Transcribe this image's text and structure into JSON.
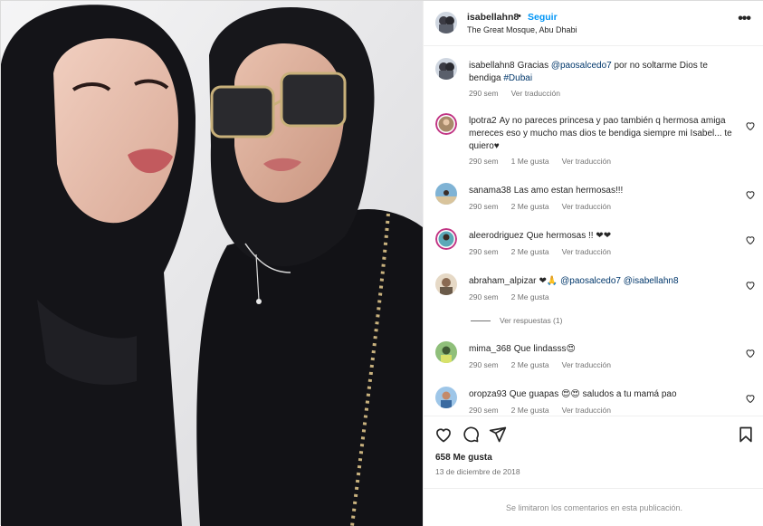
{
  "header": {
    "username": "isabellahn8",
    "separator": "•",
    "follow_label": "Seguir",
    "location": "The Great Mosque, Abu Dhabi",
    "more_icon": "more-options-icon"
  },
  "caption": {
    "username": "isabellahn8",
    "text_before": "Gracias ",
    "mention": "@paosalcedo7",
    "text_after": " por no soltarme Dios te bendiga ",
    "hashtag": "#Dubai",
    "time": "290 sem",
    "translate": "Ver traducción"
  },
  "comments": [
    {
      "username": "lpotra2",
      "text": "Ay no pareces princesa y pao también q hermosa amiga mereces eso y mucho mas dios te bendiga siempre mi Isabel... te quiero♥",
      "time": "290 sem",
      "likes": "1 Me gusta",
      "translate": "Ver traducción"
    },
    {
      "username": "sanama38",
      "text": "Las amo estan hermosas!!!",
      "time": "290 sem",
      "likes": "2 Me gusta",
      "translate": "Ver traducción"
    },
    {
      "username": "aleerodriguez",
      "text": "Que hermosas !! ❤❤",
      "time": "290 sem",
      "likes": "2 Me gusta",
      "translate": "Ver traducción"
    },
    {
      "username": "abraham_alpizar",
      "text_before": "❤🙏 ",
      "mention1": "@paosalcedo7",
      "mention2": "@isabellahn8",
      "time": "290 sem",
      "likes": "2 Me gusta"
    },
    {
      "username": "mima_368",
      "text": "Que lindasss😍",
      "time": "290 sem",
      "likes": "2 Me gusta",
      "translate": "Ver traducción"
    },
    {
      "username": "oropza93",
      "text": "Que guapas 😍😍 saludos a tu mamá pao",
      "time": "290 sem",
      "likes": "2 Me gusta",
      "translate": "Ver traducción"
    }
  ],
  "view_replies": "Ver respuestas (1)",
  "actions": {
    "like_icon": "heart-icon",
    "comment_icon": "comment-icon",
    "share_icon": "share-icon",
    "save_icon": "bookmark-icon"
  },
  "likes_count": "658 Me gusta",
  "post_date": "13 de diciembre de 2018",
  "footer_notice": "Se limitaron los comentarios en esta publicación.",
  "colors": {
    "accent": "#0095f6",
    "mention": "#00376b",
    "muted": "#737373",
    "text": "#262626"
  }
}
